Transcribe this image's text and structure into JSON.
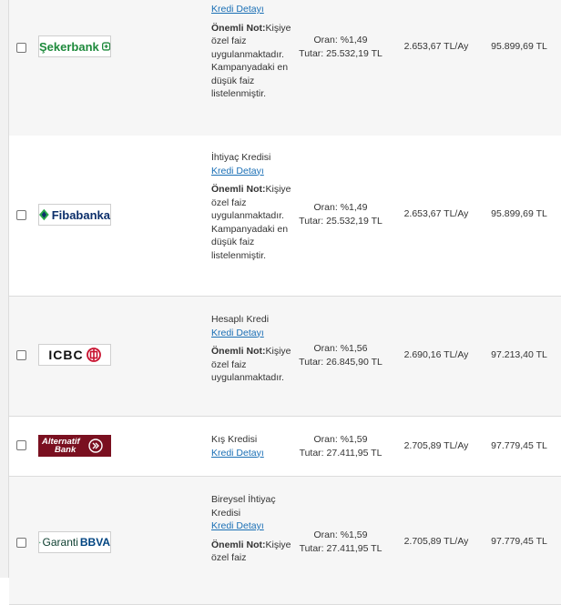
{
  "rows": [
    {
      "bank": "Şekerbank",
      "type": "",
      "link": "Kredi Detayı",
      "note_bold": "Önemli Not:",
      "note": "Kişiye özel faiz uygulanmaktadır. Kampanyadaki en düşük faiz listelenmiştir.",
      "rate": "Oran: %1,49",
      "amount": "Tutar: 25.532,19 TL",
      "monthly": "2.653,67 TL/Ay",
      "total": "95.899,69 TL"
    },
    {
      "bank": "Fibabanka",
      "type": "İhtiyaç Kredisi",
      "link": "Kredi Detayı",
      "note_bold": "Önemli Not:",
      "note": "Kişiye özel faiz uygulanmaktadır. Kampanyadaki en düşük faiz listelenmiştir.",
      "rate": "Oran: %1,49",
      "amount": "Tutar: 25.532,19 TL",
      "monthly": "2.653,67 TL/Ay",
      "total": "95.899,69 TL"
    },
    {
      "bank": "ICBC",
      "type": "Hesaplı Kredi",
      "link": "Kredi Detayı",
      "note_bold": "Önemli Not:",
      "note": "Kişiye özel faiz uygulanmaktadır.",
      "rate": "Oran: %1,56",
      "amount": "Tutar: 26.845,90 TL",
      "monthly": "2.690,16 TL/Ay",
      "total": "97.213,40 TL"
    },
    {
      "bank": "Alternatif Bank",
      "type": "Kış Kredisi",
      "link": "Kredi Detayı",
      "note_bold": "",
      "note": "",
      "rate": "Oran: %1,59",
      "amount": "Tutar: 27.411,95 TL",
      "monthly": "2.705,89 TL/Ay",
      "total": "97.779,45 TL"
    },
    {
      "bank": "Garanti BBVA",
      "type": "Bireysel İhtiyaç Kredisi",
      "link": "Kredi Detayı",
      "note_bold": "Önemli Not:",
      "note": "Kişiye özel faiz",
      "rate": "Oran: %1,59",
      "amount": "Tutar: 27.411,95 TL",
      "monthly": "2.705,89 TL/Ay",
      "total": "97.779,45 TL"
    }
  ],
  "logos": {
    "sekerbank": {
      "text": "Şekerbank",
      "color": "#1e8a3c"
    },
    "fibabanka": {
      "text": "Fibabanka",
      "color": "#0c2f6b",
      "accent": "#2aa84a"
    },
    "icbc": {
      "text": "ICBC",
      "color": "#111111",
      "accent": "#c8102e"
    },
    "alternatif": {
      "line1": "Alternatif",
      "line2": "Bank",
      "color": "#ffffff",
      "bg": "#7a1020"
    },
    "garanti": {
      "text": "Garanti",
      "text2": "BBVA",
      "color": "#0b3d2e",
      "accent": "#0a7c3c"
    }
  }
}
